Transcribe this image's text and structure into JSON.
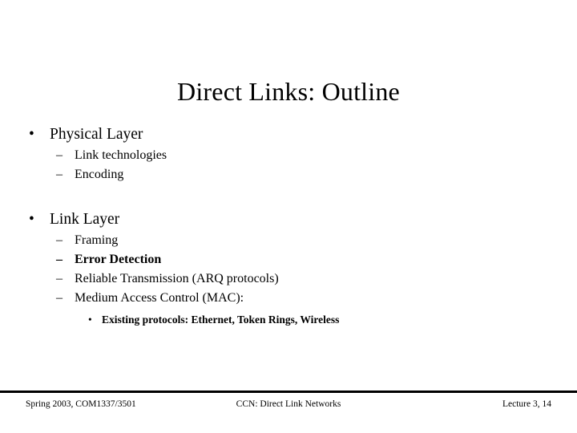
{
  "slide": {
    "title": "Direct Links: Outline",
    "background_color": "#ffffff",
    "text_color": "#000000",
    "bullet_marker_level1": "•",
    "bullet_marker_level2": "–",
    "bullet_marker_level3": "•",
    "outline": [
      {
        "level": 1,
        "text": "Physical Layer",
        "bold": false
      },
      {
        "level": 2,
        "text": "Link technologies",
        "bold": false
      },
      {
        "level": 2,
        "text": "Encoding",
        "bold": false
      },
      {
        "level": 1,
        "text": "Link Layer",
        "bold": false
      },
      {
        "level": 2,
        "text": "Framing",
        "bold": false
      },
      {
        "level": 2,
        "text": "Error Detection",
        "bold": true
      },
      {
        "level": 2,
        "text": "Reliable Transmission (ARQ protocols)",
        "bold": false
      },
      {
        "level": 2,
        "text": "Medium Access Control (MAC):",
        "bold": false
      },
      {
        "level": 3,
        "text": "Existing protocols: Ethernet, Token Rings, Wireless",
        "bold": true
      }
    ]
  },
  "footer": {
    "left": "Spring 2003, COM1337/3501",
    "center": "CCN: Direct Link Networks",
    "right": "Lecture 3, 14"
  }
}
